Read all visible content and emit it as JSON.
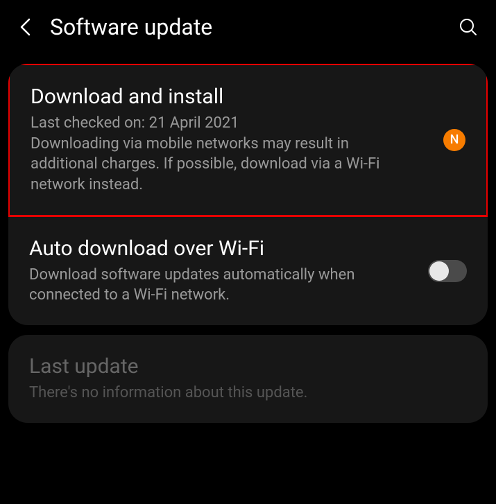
{
  "header": {
    "title": "Software update"
  },
  "download": {
    "title": "Download and install",
    "desc": "Last checked on: 21 April 2021\nDownloading via mobile networks may result in additional charges. If possible, download via a Wi-Fi network instead.",
    "badge": "N"
  },
  "auto": {
    "title": "Auto download over Wi-Fi",
    "desc": "Download software updates automatically when connected to a Wi-Fi network.",
    "toggle_on": false
  },
  "last": {
    "title": "Last update",
    "desc": "There's no information about this update."
  }
}
